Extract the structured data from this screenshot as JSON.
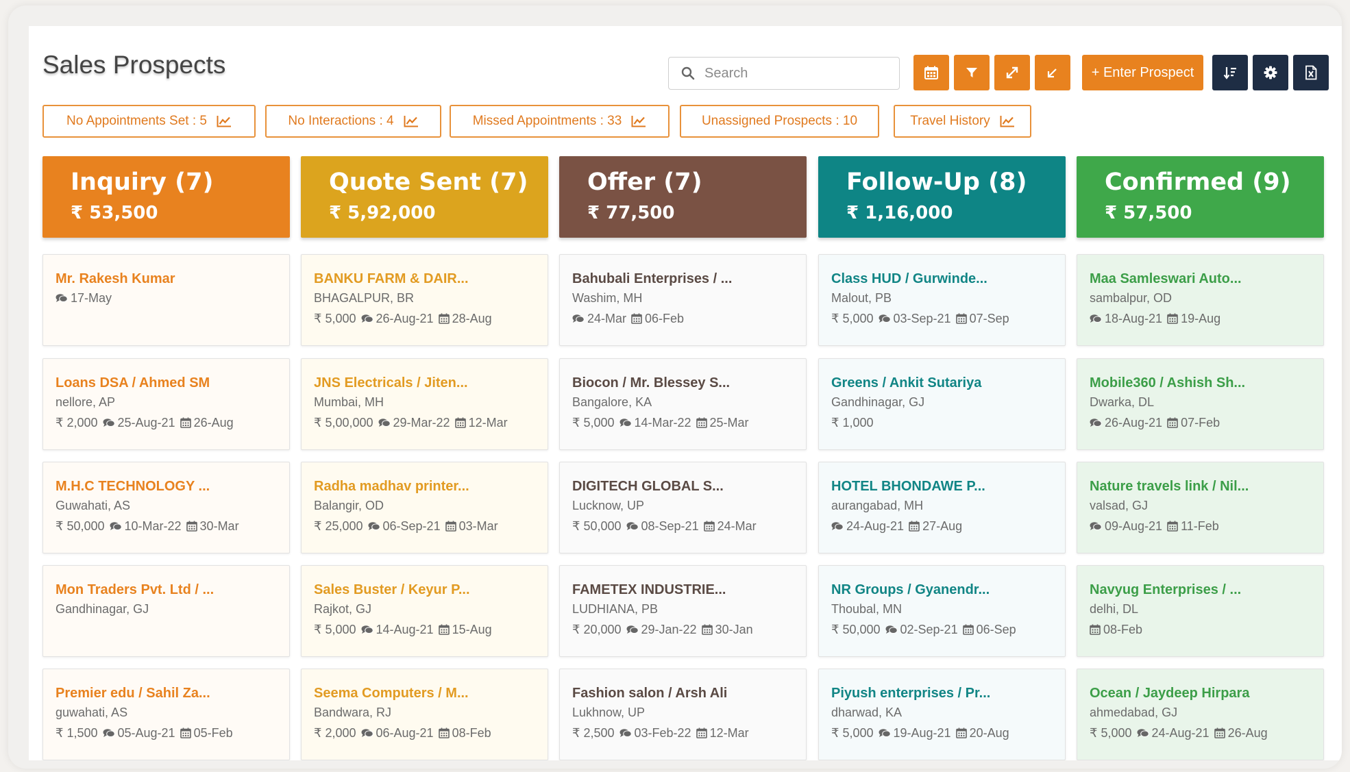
{
  "page_title": "Sales Prospects",
  "search": {
    "placeholder": "Search"
  },
  "toolbar": {
    "enter_prospect_label": "+ Enter Prospect",
    "icons": [
      "calendar-icon",
      "filter-icon",
      "expand-icon",
      "collapse-icon",
      "sort-icon",
      "gear-icon",
      "excel-export-icon"
    ]
  },
  "filters": [
    {
      "label": "No Appointments Set : 5",
      "chart_icon": true
    },
    {
      "label": "No Interactions : 4",
      "chart_icon": true
    },
    {
      "label": "Missed Appointments : 33",
      "chart_icon": true
    },
    {
      "label": "Unassigned Prospects : 10",
      "chart_icon": false
    },
    {
      "label": "Travel History",
      "chart_icon": true
    }
  ],
  "colors": {
    "accent": "#e8821f",
    "navy": "#1e2d44"
  },
  "columns": [
    {
      "title": "Inquiry (7)",
      "amount": "₹ 53,500",
      "header_color": "#e8821f",
      "name_color": "#e8821f",
      "card_bg": "#fffbf6",
      "cards": [
        {
          "name": "Mr. Rakesh Kumar",
          "location": "",
          "amount": "",
          "interaction": "17-May",
          "appointment": ""
        },
        {
          "name": "Loans DSA / Ahmed SM",
          "location": "nellore, AP",
          "amount": "₹ 2,000",
          "interaction": "25-Aug-21",
          "appointment": "26-Aug"
        },
        {
          "name": "M.H.C TECHNOLOGY ...",
          "location": "Guwahati, AS",
          "amount": "₹ 50,000",
          "interaction": "10-Mar-22",
          "appointment": "30-Mar"
        },
        {
          "name": "Mon Traders Pvt. Ltd / ...",
          "location": "Gandhinagar, GJ",
          "amount": "",
          "interaction": "",
          "appointment": ""
        },
        {
          "name": "Premier edu / Sahil Za...",
          "location": "guwahati, AS",
          "amount": "₹ 1,500",
          "interaction": "05-Aug-21",
          "appointment": "05-Feb"
        }
      ]
    },
    {
      "title": "Quote Sent (7)",
      "amount": "₹ 5,92,000",
      "header_color": "#dca41e",
      "name_color": "#e29b22",
      "card_bg": "#fffbf0",
      "cards": [
        {
          "name": "BANKU FARM & DAIR...",
          "location": "BHAGALPUR, BR",
          "amount": "₹ 5,000",
          "interaction": "26-Aug-21",
          "appointment": "28-Aug"
        },
        {
          "name": "JNS Electricals / Jiten...",
          "location": "Mumbai, MH",
          "amount": "₹ 5,00,000",
          "interaction": "29-Mar-22",
          "appointment": "12-Mar"
        },
        {
          "name": "Radha madhav printer...",
          "location": "Balangir, OD",
          "amount": "₹ 25,000",
          "interaction": "06-Sep-21",
          "appointment": "03-Mar"
        },
        {
          "name": "Sales Buster / Keyur P...",
          "location": "Rajkot, GJ",
          "amount": "₹ 5,000",
          "interaction": "14-Aug-21",
          "appointment": "15-Aug"
        },
        {
          "name": "Seema Computers / M...",
          "location": "Bandwara, RJ",
          "amount": "₹ 2,000",
          "interaction": "06-Aug-21",
          "appointment": "08-Feb"
        }
      ]
    },
    {
      "title": "Offer (7)",
      "amount": "₹ 77,500",
      "header_color": "#7a5244",
      "name_color": "#5a4a44",
      "card_bg": "#fafafa",
      "cards": [
        {
          "name": "Bahubali Enterprises / ...",
          "location": "Washim, MH",
          "amount": "",
          "interaction": "24-Mar",
          "appointment": "06-Feb"
        },
        {
          "name": "Biocon / Mr. Blessey S...",
          "location": "Bangalore, KA",
          "amount": "₹ 5,000",
          "interaction": "14-Mar-22",
          "appointment": "25-Mar"
        },
        {
          "name": "DIGITECH GLOBAL S...",
          "location": "Lucknow, UP",
          "amount": "₹ 50,000",
          "interaction": "08-Sep-21",
          "appointment": "24-Mar"
        },
        {
          "name": "FAMETEX INDUSTRIE...",
          "location": "LUDHIANA, PB",
          "amount": "₹ 20,000",
          "interaction": "29-Jan-22",
          "appointment": "30-Jan"
        },
        {
          "name": "Fashion salon / Arsh Ali",
          "location": "Lukhnow, UP",
          "amount": "₹ 2,500",
          "interaction": "03-Feb-22",
          "appointment": "12-Mar"
        }
      ]
    },
    {
      "title": "Follow-Up (8)",
      "amount": "₹ 1,16,000",
      "header_color": "#0e8585",
      "name_color": "#118585",
      "card_bg": "#f5fafb",
      "cards": [
        {
          "name": "Class HUD / Gurwinde...",
          "location": "Malout, PB",
          "amount": "₹ 5,000",
          "interaction": "03-Sep-21",
          "appointment": "07-Sep"
        },
        {
          "name": "Greens / Ankit Sutariya",
          "location": "Gandhinagar, GJ",
          "amount": "₹ 1,000",
          "interaction": "",
          "appointment": ""
        },
        {
          "name": "HOTEL BHONDAWE P...",
          "location": "aurangabad, MH",
          "amount": "",
          "interaction": "24-Aug-21",
          "appointment": "27-Aug"
        },
        {
          "name": "NR Groups / Gyanendr...",
          "location": "Thoubal, MN",
          "amount": "₹ 50,000",
          "interaction": "02-Sep-21",
          "appointment": "06-Sep"
        },
        {
          "name": "Piyush enterprises / Pr...",
          "location": "dharwad, KA",
          "amount": "₹ 5,000",
          "interaction": "19-Aug-21",
          "appointment": "20-Aug"
        }
      ]
    },
    {
      "title": "Confirmed (9)",
      "amount": "₹ 57,500",
      "header_color": "#3fa84a",
      "name_color": "#3c9e48",
      "card_bg": "#e9f5ea",
      "cards": [
        {
          "name": "Maa Samleswari Auto...",
          "location": "sambalpur, OD",
          "amount": "",
          "interaction": "18-Aug-21",
          "appointment": "19-Aug"
        },
        {
          "name": "Mobile360 / Ashish Sh...",
          "location": "Dwarka, DL",
          "amount": "",
          "interaction": "26-Aug-21",
          "appointment": "07-Feb"
        },
        {
          "name": "Nature travels link / Nil...",
          "location": "valsad, GJ",
          "amount": "",
          "interaction": "09-Aug-21",
          "appointment": "11-Feb"
        },
        {
          "name": "Navyug Enterprises / ...",
          "location": "delhi, DL",
          "amount": "",
          "interaction": "",
          "appointment": "08-Feb"
        },
        {
          "name": "Ocean / Jaydeep Hirpara",
          "location": "ahmedabad, GJ",
          "amount": "₹ 5,000",
          "interaction": "24-Aug-21",
          "appointment": "26-Aug"
        }
      ]
    }
  ]
}
